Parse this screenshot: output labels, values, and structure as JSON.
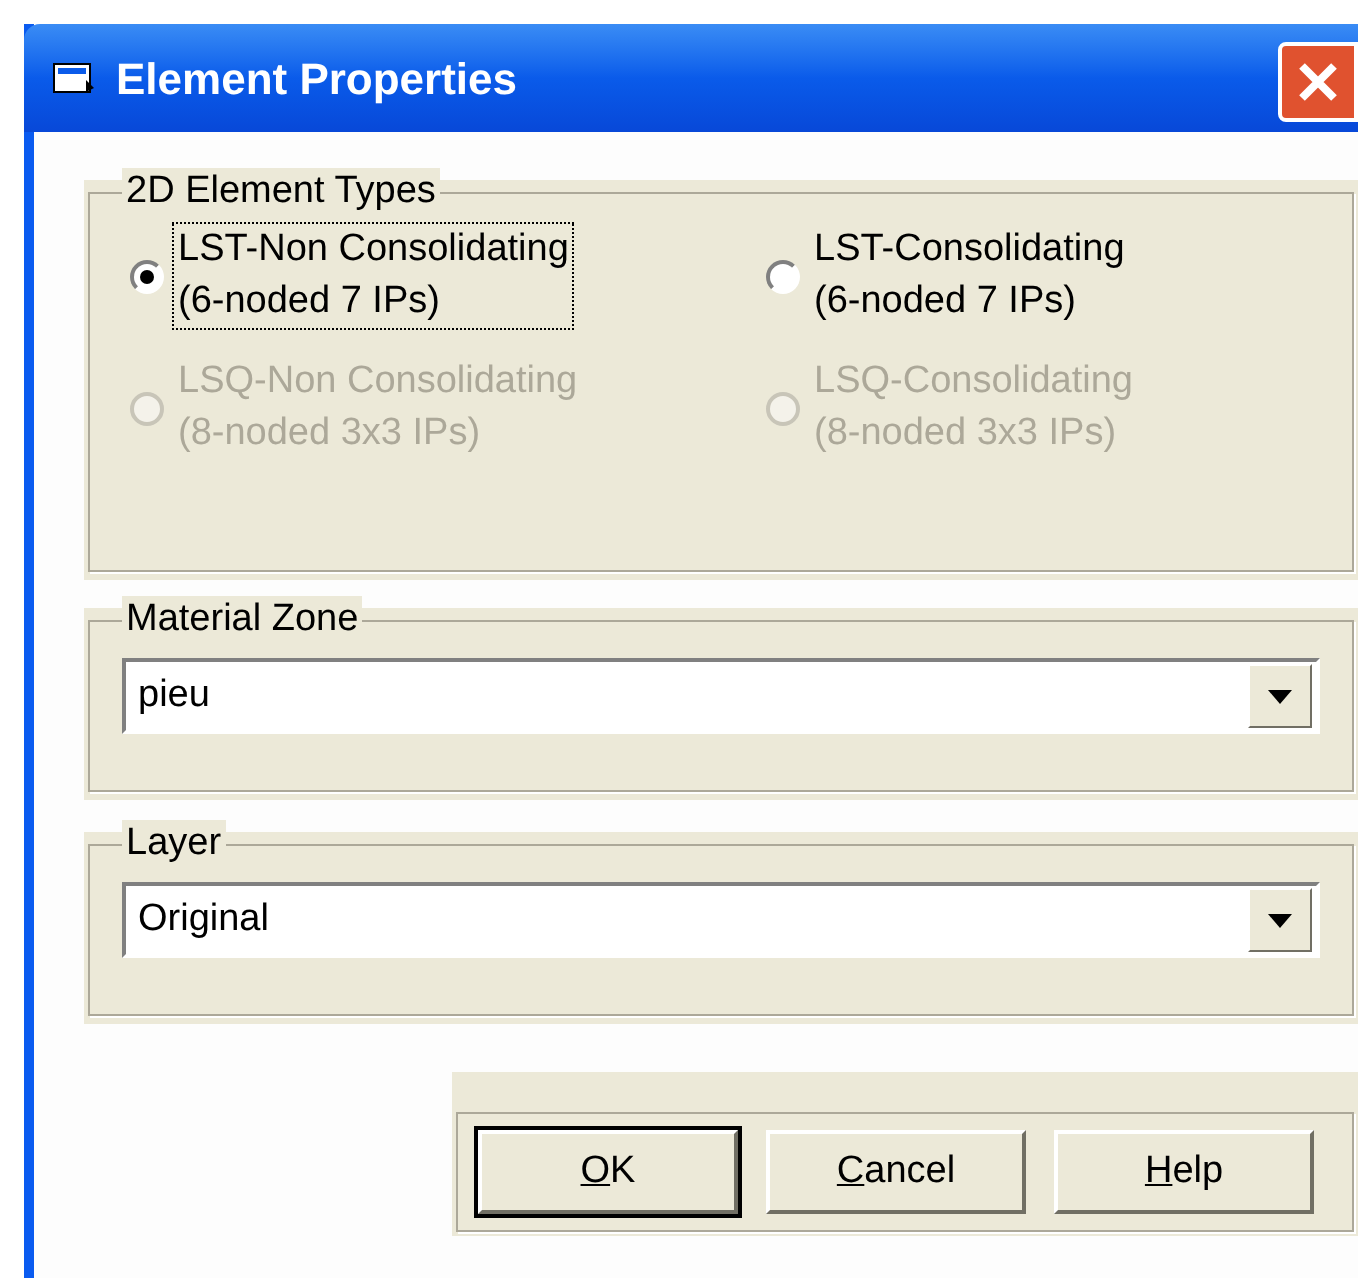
{
  "window": {
    "title": "Element Properties"
  },
  "element_types": {
    "legend": "2D Element Types",
    "options": [
      {
        "lines": [
          "LST-Non Consolidating",
          "(6-noded 7 IPs)"
        ],
        "selected": true,
        "disabled": false,
        "focused": true
      },
      {
        "lines": [
          "LST-Consolidating",
          "(6-noded 7 IPs)"
        ],
        "selected": false,
        "disabled": false,
        "focused": false
      },
      {
        "lines": [
          "LSQ-Non Consolidating",
          "(8-noded 3x3 IPs)"
        ],
        "selected": false,
        "disabled": true,
        "focused": false
      },
      {
        "lines": [
          "LSQ-Consolidating",
          "(8-noded 3x3 IPs)"
        ],
        "selected": false,
        "disabled": true,
        "focused": false
      }
    ]
  },
  "material_zone": {
    "legend": "Material Zone",
    "value": "pieu"
  },
  "layer": {
    "legend": "Layer",
    "value": "Original"
  },
  "buttons": [
    {
      "label": "OK",
      "default": true
    },
    {
      "label": "Cancel",
      "default": false
    },
    {
      "label": "Help",
      "default": false
    }
  ]
}
